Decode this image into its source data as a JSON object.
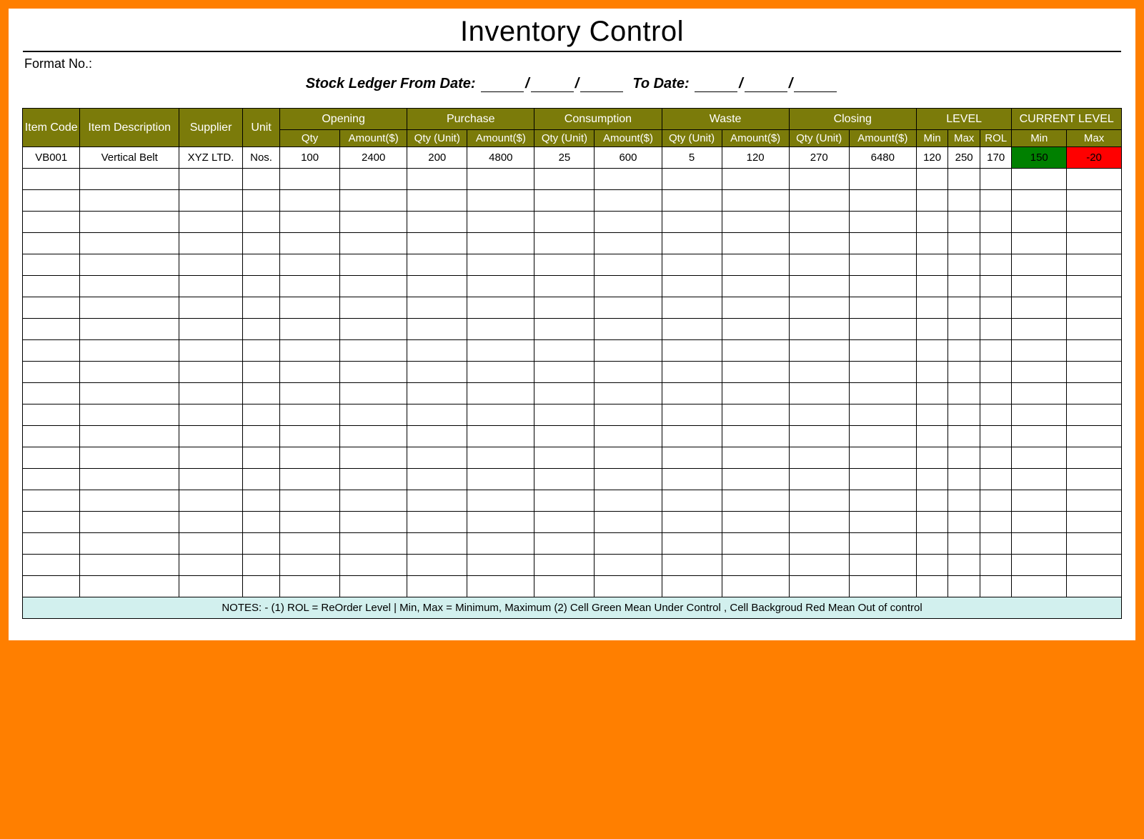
{
  "title": "Inventory Control",
  "format_label": "Format No.:",
  "ledger": {
    "prefix": "Stock Ledger From Date:",
    "to": "To Date:"
  },
  "headers": {
    "item_code": "Item Code",
    "item_desc": "Item Description",
    "supplier": "Supplier",
    "unit": "Unit",
    "opening": "Opening",
    "purchase": "Purchase",
    "consumption": "Consumption",
    "waste": "Waste",
    "closing": "Closing",
    "level": "LEVEL",
    "current_level": "CURRENT LEVEL",
    "qty": "Qty",
    "amount": "Amount($)",
    "qty_unit": "Qty (Unit)",
    "min": "Min",
    "max": "Max",
    "rol": "ROL"
  },
  "rows": [
    {
      "item_code": "VB001",
      "item_desc": "Vertical Belt",
      "supplier": "XYZ LTD.",
      "unit": "Nos.",
      "opening_qty": "100",
      "opening_amt": "2400",
      "purchase_qty": "200",
      "purchase_amt": "4800",
      "consumption_qty": "25",
      "consumption_amt": "600",
      "waste_qty": "5",
      "waste_amt": "120",
      "closing_qty": "270",
      "closing_amt": "6480",
      "level_min": "120",
      "level_max": "250",
      "level_rol": "170",
      "current_min": "150",
      "current_max": "-20",
      "current_min_status": "green",
      "current_max_status": "red"
    }
  ],
  "empty_row_count": 20,
  "notes": "NOTES: - (1) ROL = ReOrder Level | Min, Max = Minimum, Maximum     (2) Cell Green Mean Under Control , Cell Backgroud Red Mean Out of control"
}
